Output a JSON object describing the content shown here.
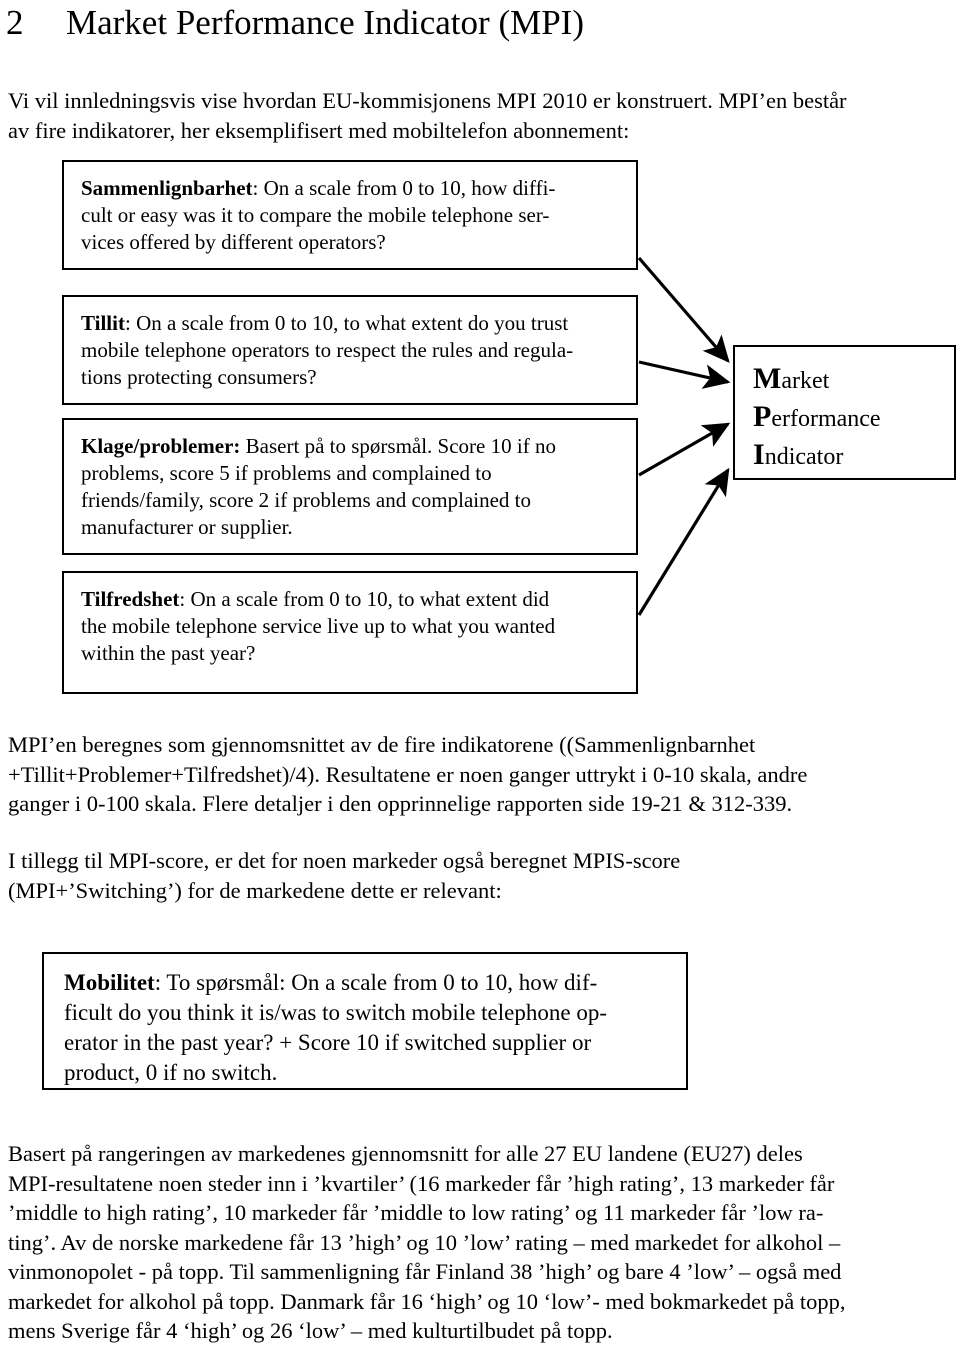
{
  "heading": {
    "section_number": "2",
    "title": "Market Performance Indicator (MPI)"
  },
  "intro": {
    "line1": "Vi vil innledningsvis vise hvordan EU-kommisjonens MPI 2010 er konstruert. MPI’en består",
    "line2": "av fire indikatorer, her eksemplifisert med mobiltelefon abonnement:"
  },
  "diagram": {
    "boxes": [
      {
        "id": "sammenlignbarhet",
        "label": "Sammenlignbarhet",
        "label_suffix": ":",
        "body": " On a scale from 0 to 10, how diffi-cult or easy was it to compare the mobile telephone ser-vices offered by different operators?",
        "line1": " On a scale from 0 to 10, how diffi-",
        "line2": "cult or easy was it to compare the mobile telephone ser-",
        "line3": "vices offered by different operators?"
      },
      {
        "id": "tillit",
        "label": "Tillit",
        "label_suffix": ":",
        "line1": " On a scale from 0 to 10, to what extent do you trust",
        "line2": "mobile telephone operators to respect the rules and regula-",
        "line3": "tions protecting consumers?"
      },
      {
        "id": "klage",
        "label": "Klage/problemer:",
        "label_suffix": "",
        "line1": " Basert på to spørsmål. Score 10 if no",
        "line2": "problems, score 5 if problems and complained to",
        "line3": "friends/family, score 2 if problems and complained to",
        "line4": "manufacturer or supplier."
      },
      {
        "id": "tilfredshet",
        "label": "Tilfredshet",
        "label_suffix": ":",
        "line1": " On a scale from 0 to 10, to what extent did",
        "line2": "the mobile telephone service live up to what you wanted",
        "line3": "within the past year?"
      }
    ],
    "target": {
      "id": "mpi",
      "line1_cap": "M",
      "line1_rest": "arket",
      "line2_cap": "P",
      "line2_rest": "erformance",
      "line3_cap": "I",
      "line3_rest": "ndicator"
    },
    "arrow_count": 4,
    "stroke_color": "#000000"
  },
  "mpi_calc": {
    "line1": "MPI’en beregnes som gjennomsnittet av de fire indikatorene ((Sammenlignbarnhet",
    "line2": "+Tillit+Problemer+Tilfredshet)/4). Resultatene er noen ganger uttrykt i 0-10 skala, andre",
    "line3": "ganger i 0-100 skala. Flere detaljer i den opprinnelige rapporten side 19-21 & 312-339."
  },
  "mpis": {
    "line1": "I tillegg til MPI-score, er det for noen markeder også beregnet MPIS-score",
    "line2": "(MPI+’Switching’) for de markedene dette er relevant:"
  },
  "mobilitet": {
    "label": "Mobilitet",
    "label_suffix": ":",
    "line1": " To spørsmål: On a scale from 0 to 10,  how dif-",
    "line2": "ficult do you think it is/was to switch mobile telephone op-",
    "line3": "erator in the past year? + Score 10 if switched supplier or",
    "line4": "product, 0 if no switch."
  },
  "ranking": {
    "line1": "Basert på rangeringen av markedenes gjennomsnitt for alle 27 EU landene (EU27) deles",
    "line2": "MPI-resultatene noen steder inn i ’kvartiler’ (16 markeder får ’high rating’, 13 markeder får",
    "line3": "’middle to high rating’, 10 markeder får ’middle to low rating’ og 11 markeder får ’low ra-",
    "line4": "ting’.  Av de norske markedene får 13 ’high’ og 10 ’low’ rating – med markedet for alkohol –",
    "line5": "vinmonopolet - på topp. Til sammenligning får Finland 38 ’high’ og bare 4 ’low’ – også med",
    "line6": "markedet for alkohol på topp. Danmark får 16 ‘high’ og 10 ‘low’- med bokmarkedet på topp,",
    "line7": "mens Sverige får 4 ‘high’ og 26 ‘low’ – med kulturtilbudet på topp."
  }
}
